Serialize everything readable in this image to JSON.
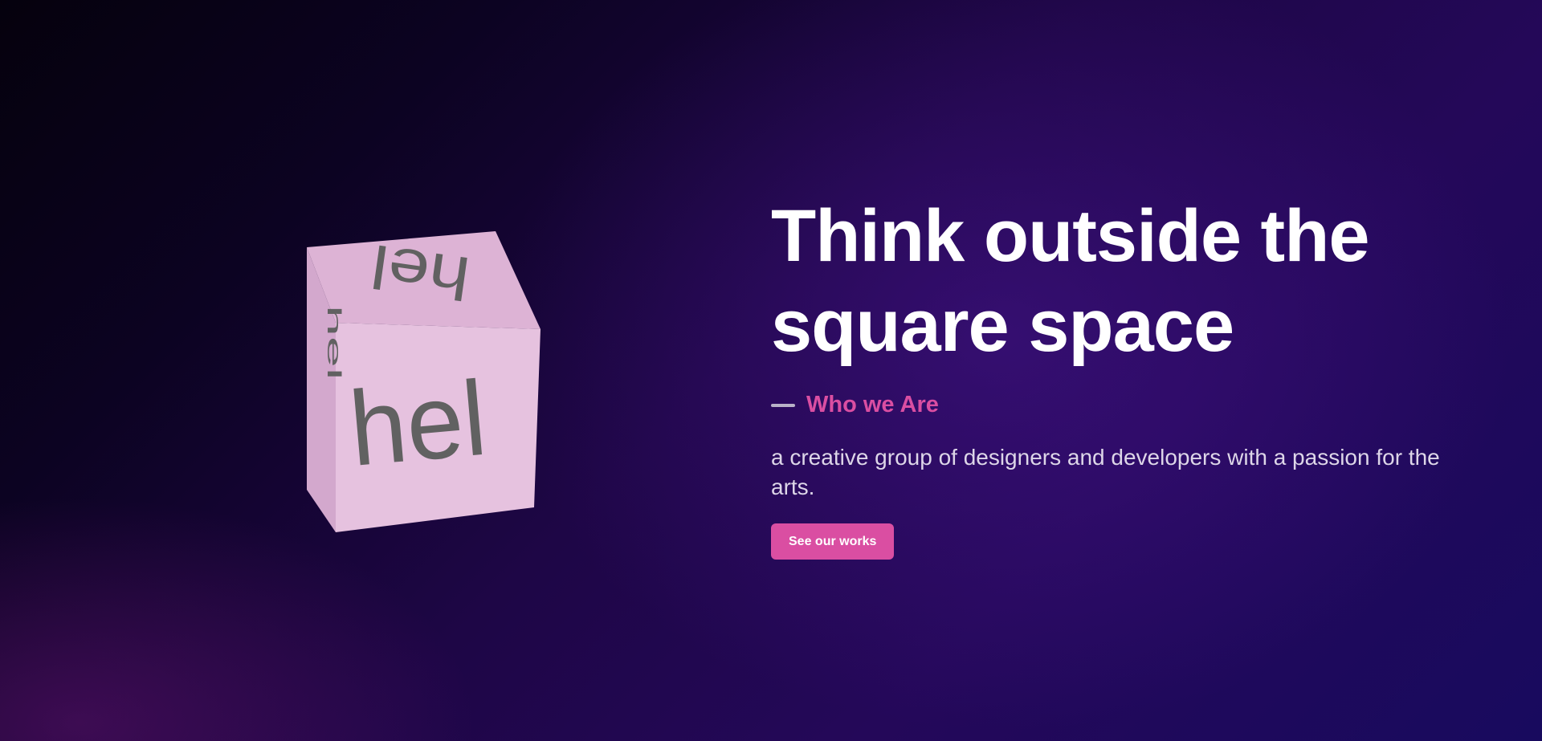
{
  "hero": {
    "headline_line1": "Think outside the",
    "headline_line2": "square space",
    "subtitle": "Who we Are",
    "description": "a creative group of designers and developers with a passion for the arts.",
    "cta_label": "See our works"
  },
  "cube": {
    "face_text": "hel",
    "face_color": "#e6c2df",
    "text_color": "#616161"
  },
  "colors": {
    "accent": "#da4ea2",
    "background_dark": "#05010d",
    "background_purple": "#240859"
  }
}
